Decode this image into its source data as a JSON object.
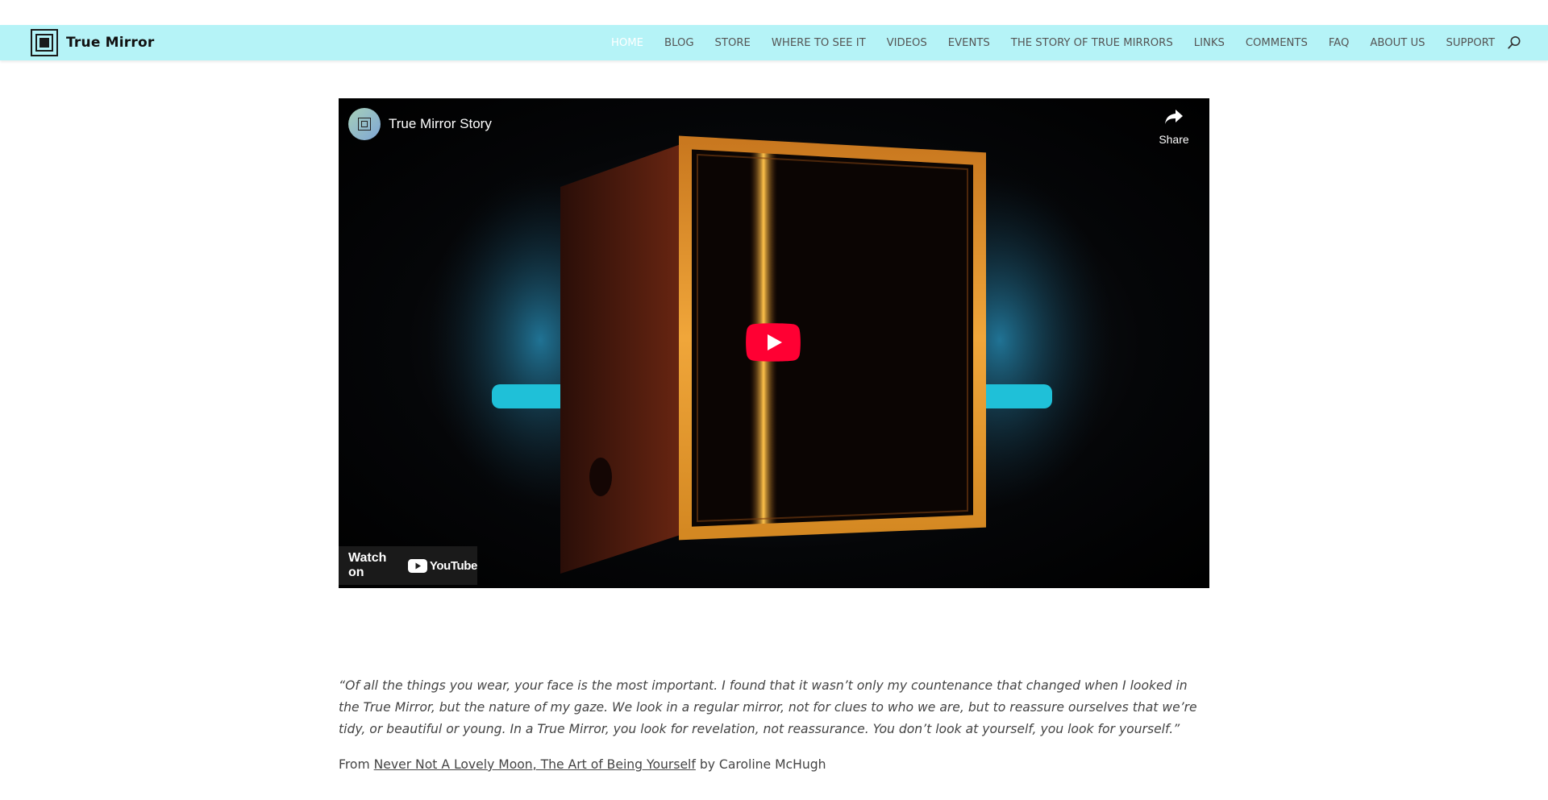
{
  "header": {
    "logo_text": "True Mirror",
    "nav": [
      "HOME",
      "BLOG",
      "STORE",
      "WHERE TO SEE IT",
      "VIDEOS",
      "EVENTS",
      "THE STORY OF TRUE MIRRORS",
      "LINKS",
      "COMMENTS",
      "FAQ",
      "ABOUT US",
      "SUPPORT"
    ],
    "active_nav": "HOME",
    "bar_color": "#b5f3f7"
  },
  "video": {
    "title": "True Mirror Story",
    "share_label": "Share",
    "watch_on_label": "Watch on",
    "yt_word": "YouTube",
    "play_color": "#ff0033"
  },
  "quote": {
    "text": "“Of all the things you wear, your face is the most important. I found that it wasn’t only my countenance that changed when I looked in the True Mirror, but the nature of my gaze. We look in a regular mirror, not for clues to who we are, but to reassure ourselves that we’re tidy, or beautiful or young. In a True Mirror, you look for revelation, not reassurance. You don’t look at yourself, you look for yourself.”",
    "from_prefix": "From",
    "book_title": "Never Not A Lovely Moon, The Art of Being Yourself",
    "author_suffix": "by Caroline McHugh"
  }
}
